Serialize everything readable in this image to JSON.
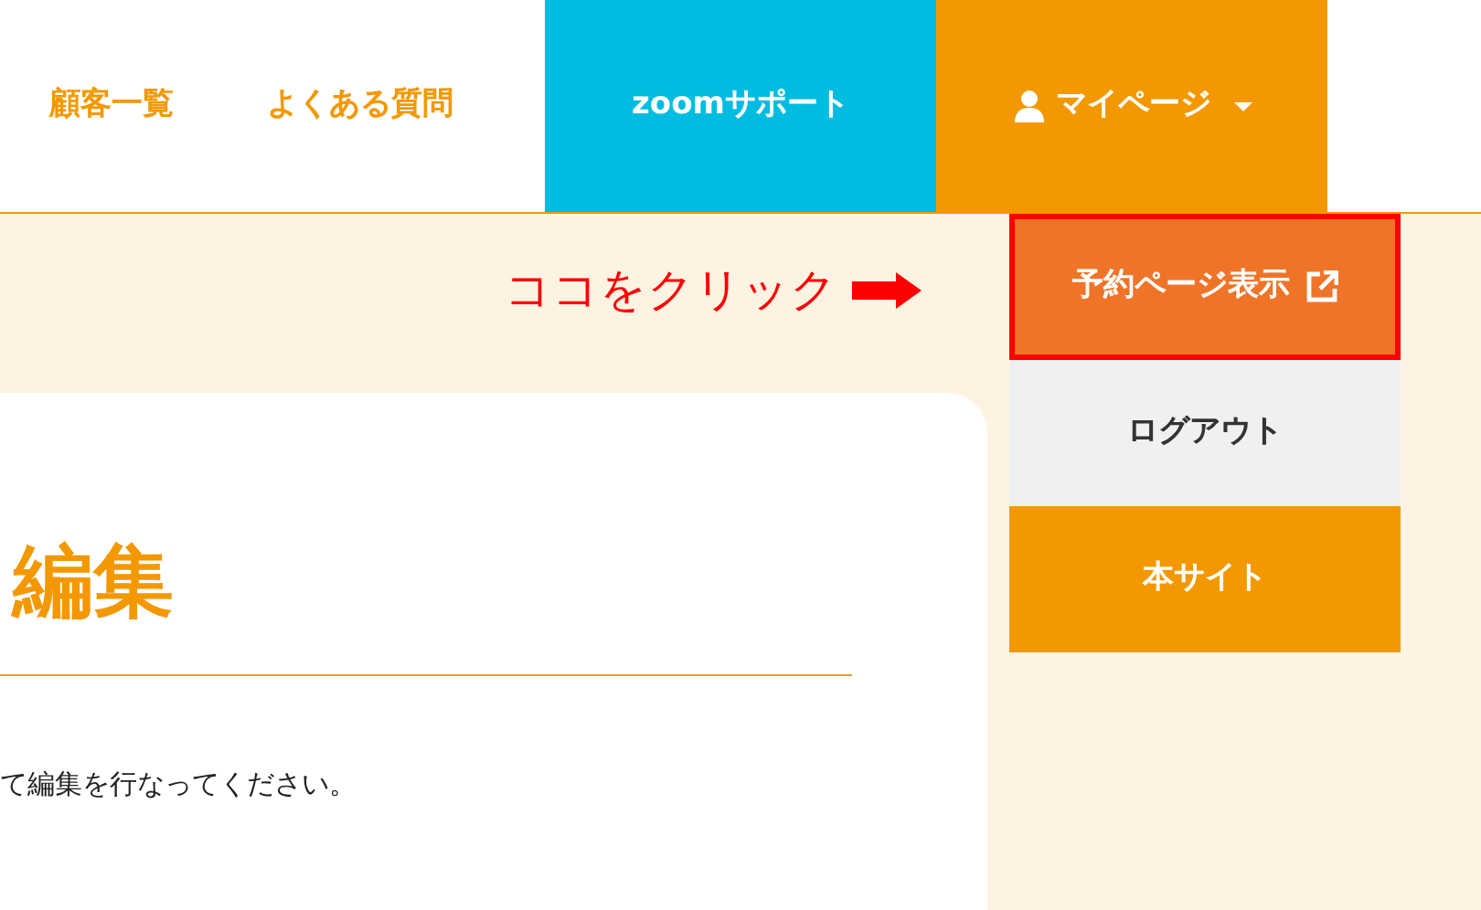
{
  "nav": {
    "items": [
      {
        "label": "顧客一覧",
        "kind": "link"
      },
      {
        "label": "よくある質問",
        "kind": "link"
      },
      {
        "label": "zoomサポート",
        "kind": "support"
      },
      {
        "label": "マイページ",
        "kind": "account",
        "expanded": true
      }
    ]
  },
  "dropdown": [
    {
      "label": "予約ページ表示",
      "kind": "reserve",
      "external": true,
      "highlighted": true
    },
    {
      "label": "ログアウト",
      "kind": "logout",
      "external": false,
      "highlighted": false
    },
    {
      "label": "本サイト",
      "kind": "site",
      "external": false,
      "highlighted": false
    }
  ],
  "annotation": {
    "text": "ココをクリック"
  },
  "content": {
    "heading": "編集",
    "text": "て編集を行なってください。"
  }
}
